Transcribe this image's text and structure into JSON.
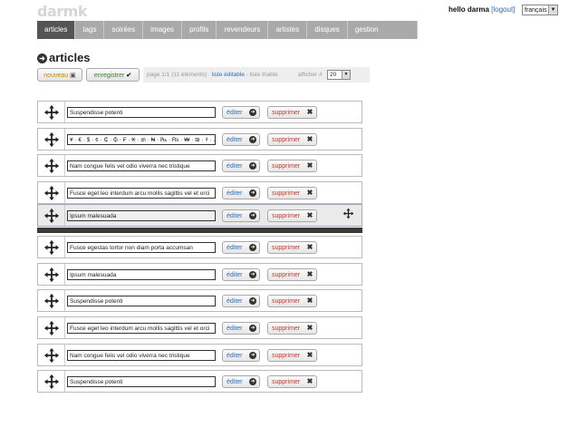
{
  "app": {
    "logo": "darmk"
  },
  "user": {
    "greeting": "hello darma",
    "logout": "[logout]"
  },
  "language": {
    "selected": "français"
  },
  "nav": {
    "tabs": [
      "articles",
      "tags",
      "soirées",
      "images",
      "profils",
      "revendeurs",
      "artistes",
      "disques",
      "gestion utilisateurs"
    ],
    "active": 0
  },
  "page": {
    "title": "articles"
  },
  "toolbar": {
    "new_label": "nouveau",
    "save_label": "enregistrer",
    "page_info": "page 1/1 (11 éléments)",
    "editable": "liste éditable",
    "sortable": "- liste triable",
    "per_page_label": "afficher #",
    "per_page_value": "20"
  },
  "row_buttons": {
    "edit": "éditer",
    "delete": "supprimer"
  },
  "rows": [
    {
      "title": "Suspendisse potenti"
    },
    {
      "title": "¥ · € · $ · ¢ · ₵ · ₲ · ₣ · ₭ · ₥ · ₦ · ₧ · ₨ · ₩ · ₪ · ₫ · ₯ · ₰"
    },
    {
      "title": "Nam congue felis vel odio viverra nec tristique"
    },
    {
      "title": "Fusce eget leo interdum arcu mollis sagittis vel et orci"
    },
    {
      "title": "Ipsum malesuada",
      "dragging": true
    },
    {
      "title": "Fusce egestas tortor non diam porta accumsan"
    },
    {
      "title": "Ipsum malesuada"
    },
    {
      "title": "Suspendisse potenti"
    },
    {
      "title": "Fusce eget leo interdum arcu mollis sagittis vel et orci"
    },
    {
      "title": "Nam congue felis vel odio viverra nec tristique"
    },
    {
      "title": "Suspendisse potenti"
    }
  ]
}
